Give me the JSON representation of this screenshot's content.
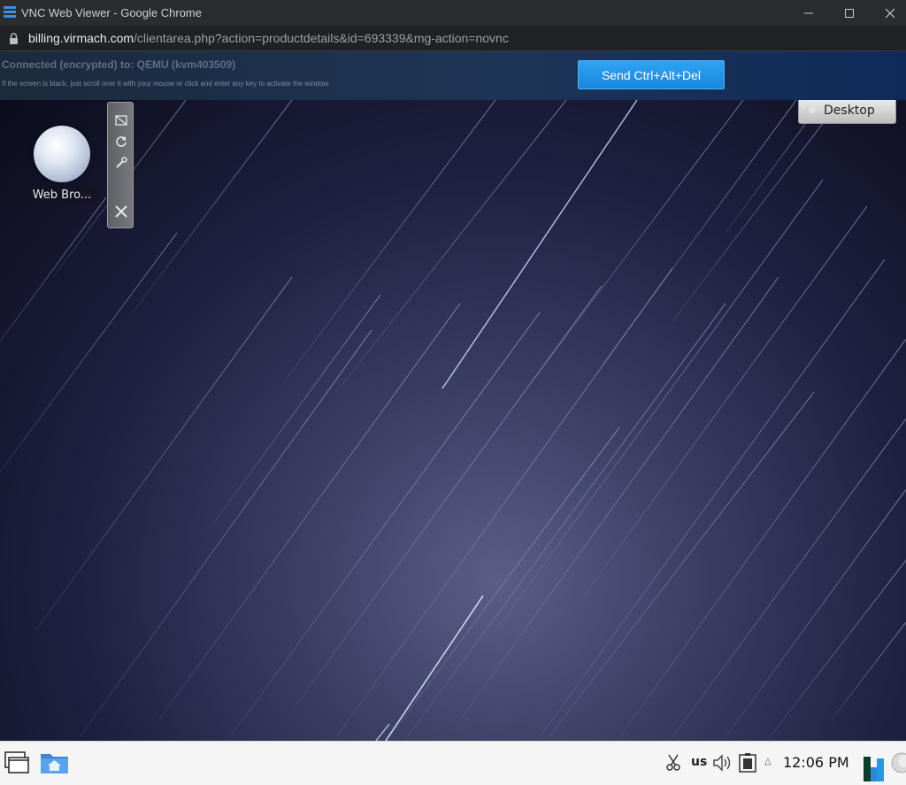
{
  "window": {
    "title": "VNC Web Viewer - Google Chrome",
    "minimize_icon": "minimize-icon",
    "maximize_icon": "maximize-icon",
    "close_icon": "close-icon"
  },
  "address": {
    "host": "billing.virmach.com",
    "path": "/clientarea.php?action=productdetails&id=693339&mg-action=novnc"
  },
  "vnc": {
    "status": "Connected (encrypted) to: QEMU (kvm403509)",
    "hint": "If the screen is black, just scroll over it with your mouse or click and enter any key to activate the window.",
    "cad_label": "Send Ctrl+Alt+Del",
    "accent": "#1f8fe8"
  },
  "desktop": {
    "icon_label": "Web Bro...",
    "desktop_button": "Desktop"
  },
  "taskbar": {
    "keyboard_layout": "us",
    "clock": "12:06 PM",
    "tray_caret": "△"
  }
}
